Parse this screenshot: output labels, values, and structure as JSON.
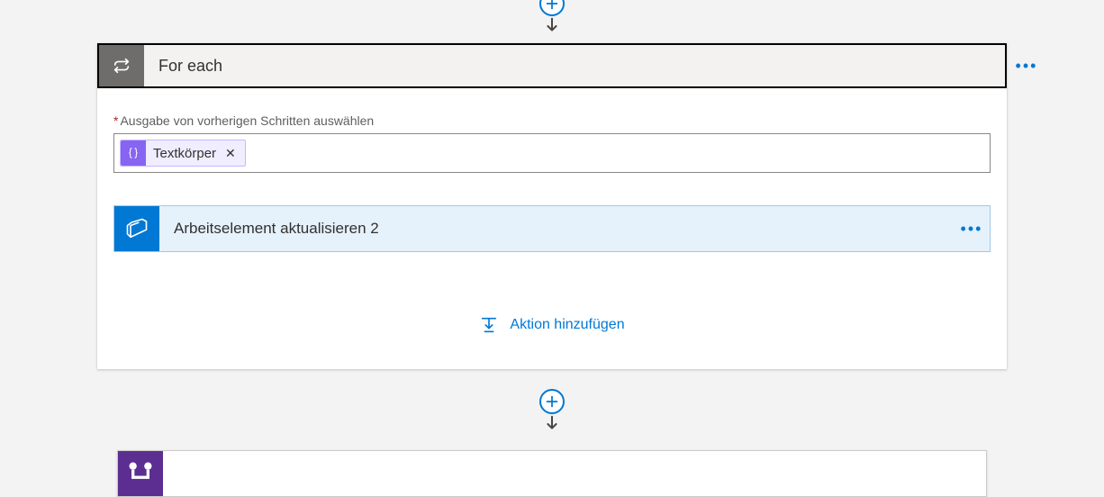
{
  "for_each": {
    "title": "For each",
    "input_label": "Ausgabe von vorherigen Schritten auswählen",
    "token_label": "Textkörper",
    "inner_action_title": "Arbeitselement aktualisieren 2",
    "add_action_label": "Aktion hinzufügen"
  },
  "colors": {
    "accent": "#0078d4",
    "token_bg": "#8764f2",
    "devops": "#0078d4",
    "peek": "#5c2e91"
  }
}
